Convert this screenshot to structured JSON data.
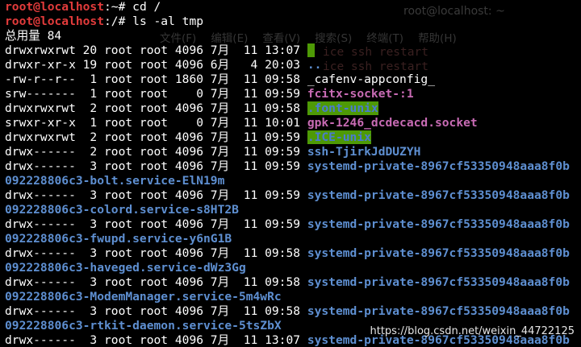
{
  "ghost": {
    "title": "root@localhost: ~",
    "menu": [
      "文件(F)",
      "编辑(E)",
      "查看(V)",
      "搜索(S)",
      "终端(T)",
      "帮助(H)"
    ],
    "line1": "ice ssh restart",
    "line2": "ice ssh restart"
  },
  "terminal": {
    "prompt1": "root@localhost",
    "prompt1_rest": ":~# cd /",
    "prompt2": "root@localhost",
    "prompt2_rest": ":/# ls -al tmp",
    "total": "总用量 84",
    "entries": [
      {
        "meta": "drwxrwxrwt 20 root root 4096 7月  11 13:07 ",
        "name": ".",
        "style": "hl-plain"
      },
      {
        "meta": "drwxr-xr-x 19 root root 4096 6月   4 20:03 ",
        "name": "..",
        "style": "blue"
      },
      {
        "meta": "-rw-r--r--  1 root root 1860 7月  11 09:58 ",
        "name": "_cafenv-appconfig_",
        "style": ""
      },
      {
        "meta": "srw-------  1 root root    0 7月  11 09:59 ",
        "name": "fcitx-socket-:1",
        "style": "pink"
      },
      {
        "meta": "drwxrwxrwt  2 root root 4096 7月  11 09:58 ",
        "name": ".font-unix",
        "style": "hl"
      },
      {
        "meta": "srwxr-xr-x  1 root root    0 7月  11 10:01 ",
        "name": "gpk-1246_dcdecacd.socket",
        "style": "pink"
      },
      {
        "meta": "drwxrwxrwt  2 root root 4096 7月  11 09:59 ",
        "name": ".ICE-unix",
        "style": "hl"
      },
      {
        "meta": "drwx------  2 root root 4096 7月  11 09:59 ",
        "name": "ssh-TjirkJdDUZYH",
        "style": "blue"
      },
      {
        "meta": "drwx------  3 root root 4096 7月  11 09:59 ",
        "name": "systemd-private-8967cf53350948aaa8f0b",
        "style": "blue",
        "wrap": "092228806c3-bolt.service-ElN19m"
      },
      {
        "meta": "drwx------  3 root root 4096 7月  11 09:59 ",
        "name": "systemd-private-8967cf53350948aaa8f0b",
        "style": "blue",
        "wrap": "092228806c3-colord.service-s8HT2B"
      },
      {
        "meta": "drwx------  3 root root 4096 7月  11 09:59 ",
        "name": "systemd-private-8967cf53350948aaa8f0b",
        "style": "blue",
        "wrap": "092228806c3-fwupd.service-y6nG1B"
      },
      {
        "meta": "drwx------  3 root root 4096 7月  11 09:58 ",
        "name": "systemd-private-8967cf53350948aaa8f0b",
        "style": "blue",
        "wrap": "092228806c3-haveged.service-dWz3Gg"
      },
      {
        "meta": "drwx------  3 root root 4096 7月  11 09:58 ",
        "name": "systemd-private-8967cf53350948aaa8f0b",
        "style": "blue",
        "wrap": "092228806c3-ModemManager.service-5m4wRc"
      },
      {
        "meta": "drwx------  3 root root 4096 7月  11 09:58 ",
        "name": "systemd-private-8967cf53350948aaa8f0b",
        "style": "blue",
        "wrap": "092228806c3-rtkit-daemon.service-5tsZbX"
      },
      {
        "meta": "drwx------  3 root root 4096 7月  11 13:07 ",
        "name": "systemd-private-8967cf53350948aaa8f0b",
        "style": "blue"
      }
    ]
  },
  "watermark": "https://blog.csdn.net/weixin_44722125"
}
